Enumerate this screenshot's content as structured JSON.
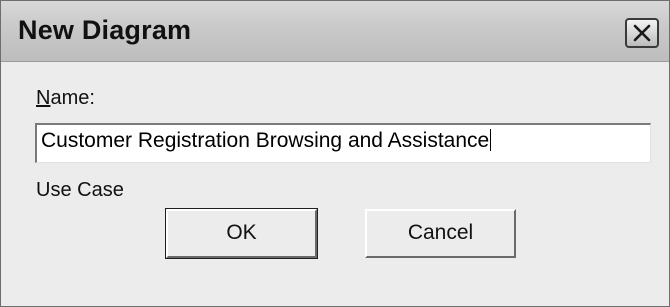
{
  "window": {
    "title": "New Diagram",
    "close_icon": "close-icon"
  },
  "form": {
    "name_label_mnemonic": "N",
    "name_label_rest": "ame:",
    "name_value": "Customer Registration Browsing and Assistance",
    "diagram_type": "Use Case"
  },
  "buttons": {
    "ok_label": "OK",
    "cancel_label": "Cancel"
  }
}
